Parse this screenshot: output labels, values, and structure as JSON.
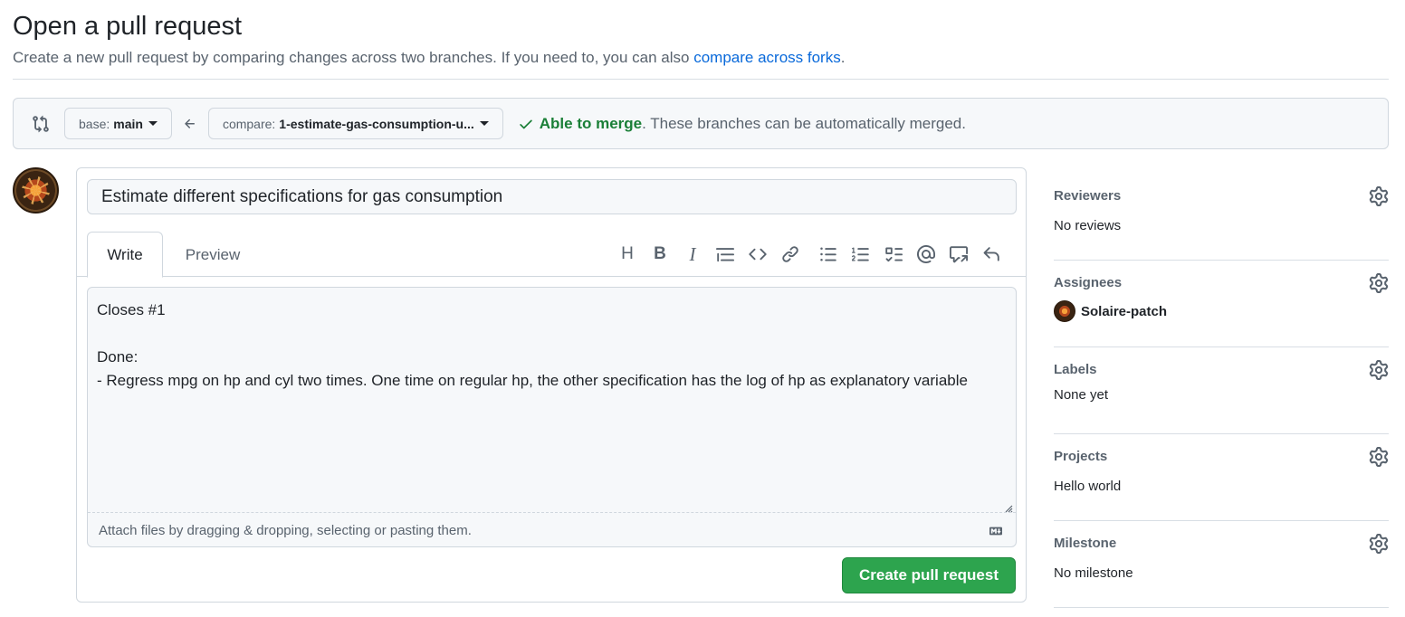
{
  "header": {
    "title": "Open a pull request",
    "subtitle_prefix": "Create a new pull request by comparing changes across two branches. If you need to, you can also ",
    "subtitle_link": "compare across forks",
    "subtitle_suffix": "."
  },
  "range": {
    "base_label": "base:",
    "base_branch": "main",
    "compare_label": "compare:",
    "compare_branch": "1-estimate-gas-consumption-u...",
    "merge_ok": "Able to merge",
    "merge_msg": ". These branches can be automatically merged."
  },
  "composer": {
    "title_value": "Estimate different specifications for gas consumption",
    "tabs": [
      "Write",
      "Preview"
    ],
    "body_value": "Closes #1\n\nDone:\n- Regress mpg on hp and cyl two times. One time on regular hp, the other specification has the log of hp as explanatory variable",
    "toolbar_icons": [
      "heading-icon",
      "bold-icon",
      "italic-icon",
      "quote-icon",
      "code-icon",
      "link-icon",
      "unordered-list-icon",
      "ordered-list-icon",
      "task-list-icon",
      "mention-icon",
      "reference-icon",
      "undo-icon"
    ],
    "toolbar_text": {
      "heading": "H",
      "bold": "B",
      "italic": "I"
    },
    "attach_hint": "Attach files by dragging & dropping, selecting or pasting them.",
    "submit_label": "Create pull request"
  },
  "sidebar": {
    "reviewers": {
      "heading": "Reviewers",
      "value": "No reviews"
    },
    "assignees": {
      "heading": "Assignees",
      "value": "Solaire-patch"
    },
    "labels": {
      "heading": "Labels",
      "value": "None yet"
    },
    "projects": {
      "heading": "Projects",
      "value": "Hello world"
    },
    "milestone": {
      "heading": "Milestone",
      "value": "No milestone"
    }
  },
  "colors": {
    "accent_link": "#0969da",
    "success": "#1a7f37",
    "primary_button": "#2da44e",
    "border": "#d0d7de",
    "muted_text": "#59636e"
  }
}
